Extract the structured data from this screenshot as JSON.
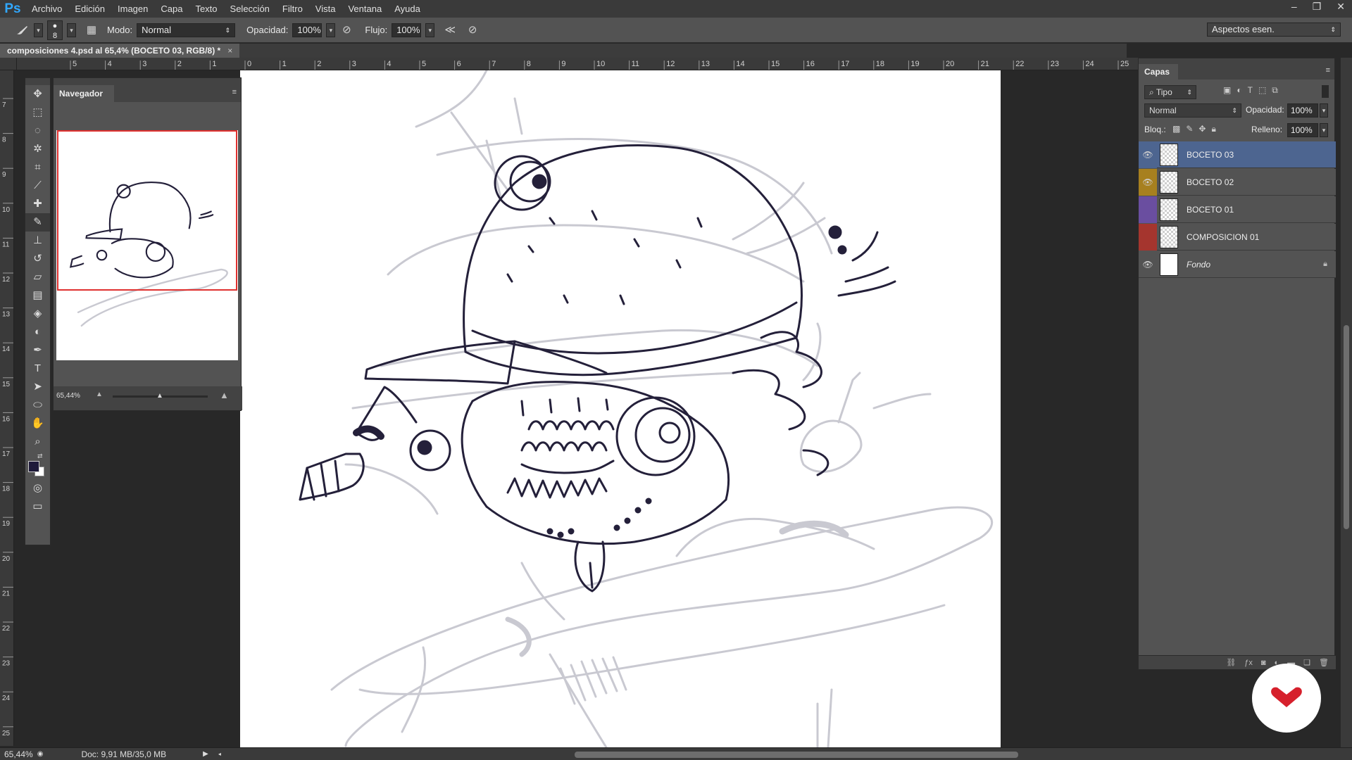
{
  "app": {
    "logo": "Ps"
  },
  "menu": [
    "Archivo",
    "Edición",
    "Imagen",
    "Capa",
    "Texto",
    "Selección",
    "Filtro",
    "Vista",
    "Ventana",
    "Ayuda"
  ],
  "window_controls": {
    "minimize": "–",
    "restore": "❐",
    "close": "✕"
  },
  "options_bar": {
    "brush_size": "8",
    "mode_label": "Modo:",
    "mode_value": "Normal",
    "opacity_label": "Opacidad:",
    "opacity_value": "100%",
    "flow_label": "Flujo:",
    "flow_value": "100%",
    "workspace": "Aspectos esen."
  },
  "document": {
    "tab_title": "composiciones 4.psd al 65,4% (BOCETO 03, RGB/8) *",
    "tab_close": "×"
  },
  "ruler_h": [
    "5",
    "4",
    "3",
    "2",
    "1",
    "0",
    "1",
    "2",
    "3",
    "4",
    "5",
    "6",
    "7",
    "8",
    "9",
    "10",
    "11",
    "12",
    "13",
    "14",
    "15",
    "16",
    "17",
    "18",
    "19",
    "20",
    "21",
    "22",
    "23",
    "24",
    "25"
  ],
  "ruler_v": [
    "7",
    "8",
    "9",
    "10",
    "11",
    "12",
    "13",
    "14",
    "15",
    "16",
    "17",
    "18",
    "19",
    "20",
    "21",
    "22",
    "23",
    "24",
    "25"
  ],
  "navigator": {
    "title": "Navegador",
    "zoom": "65,44%"
  },
  "layers": {
    "title": "Capas",
    "filter": "Tipo",
    "blend_mode": "Normal",
    "opacity_label": "Opacidad:",
    "opacity_value": "100%",
    "lock_label": "Bloq.:",
    "fill_label": "Relleno:",
    "fill_value": "100%",
    "items": [
      {
        "name": "BOCETO 03",
        "selected": true,
        "vis_color": "#4d6590",
        "visible": true,
        "thumb": "transparent"
      },
      {
        "name": "BOCETO 02",
        "selected": false,
        "vis_color": "#a7801f",
        "visible": true,
        "thumb": "transparent"
      },
      {
        "name": "BOCETO 01",
        "selected": false,
        "vis_color": "#6a4ea0",
        "visible": false,
        "thumb": "transparent"
      },
      {
        "name": "COMPOSICION 01",
        "selected": false,
        "vis_color": "#a5352e",
        "visible": false,
        "thumb": "transparent"
      },
      {
        "name": "Fondo",
        "selected": false,
        "vis_color": "",
        "visible": true,
        "thumb": "white",
        "locked": true,
        "italic": true
      }
    ]
  },
  "status": {
    "zoom": "65,44%",
    "doc": "Doc: 9,91 MB/35,0 MB"
  },
  "colors": {
    "accent_selected": "#4d6590",
    "nav_frame": "#e0312f",
    "sketch_dark": "#24203a",
    "sketch_light": "#c9c9d1",
    "badge_logo": "#d6202c"
  }
}
